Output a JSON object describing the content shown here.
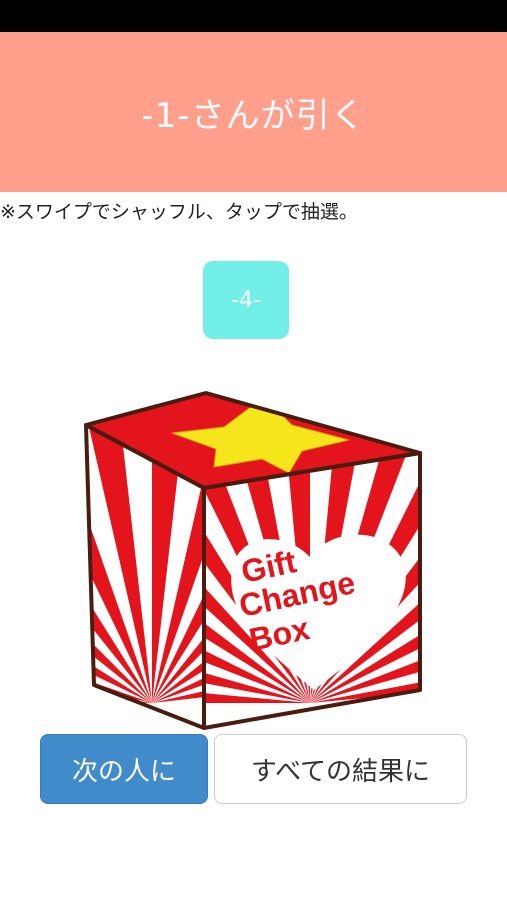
{
  "header": {
    "title": "-1-さんが引く",
    "bg_color": "#ff9f8c"
  },
  "instruction": "※スワイプでシャッフル、タップで抽選。",
  "number_badge": {
    "label": "-4-",
    "bg_color": "#72efe9"
  },
  "gift_box": {
    "logo_lines": [
      "Gift",
      "Change",
      "Box"
    ],
    "colors": {
      "red": "#e4141c",
      "star": "#f5e61b",
      "outline": "#4a1c10"
    }
  },
  "buttons": {
    "next_label": "次の人に",
    "next_color": "#428bca",
    "all_results_label": "すべての結果に"
  }
}
